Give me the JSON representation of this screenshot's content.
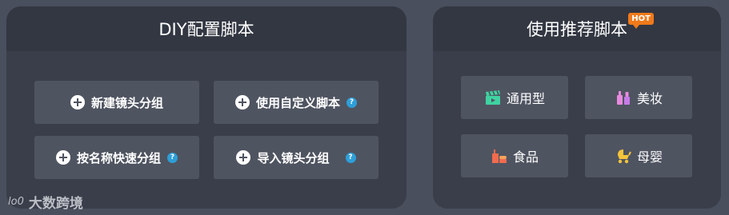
{
  "diy_panel": {
    "title": "DIY配置脚本",
    "buttons": {
      "new_group": "新建镜头分组",
      "custom_script": "使用自定义脚本",
      "quick_group": "按名称快速分组",
      "import_group": "导入镜头分组"
    },
    "help_glyph": "?"
  },
  "recommend_panel": {
    "title": "使用推荐脚本",
    "badge": "HOT",
    "categories": [
      {
        "label": "通用型",
        "icon": "clapperboard-icon"
      },
      {
        "label": "美妆",
        "icon": "cosmetics-icon"
      },
      {
        "label": "食品",
        "icon": "food-icon"
      },
      {
        "label": "母婴",
        "icon": "stroller-icon"
      }
    ]
  },
  "watermark": {
    "logo": "lo0",
    "text": "大数跨境"
  },
  "colors": {
    "background": "#4a4f5e",
    "panel": "#3a3e4a",
    "panel_header": "#333742",
    "button": "#4f5461",
    "hot": "#f07a1b",
    "help": "#2e9fd8"
  }
}
